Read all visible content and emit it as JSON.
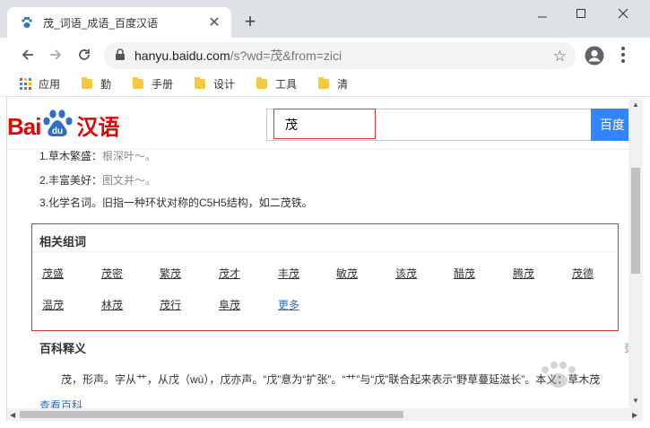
{
  "browser": {
    "tab_title": "茂_词语_成语_百度汉语",
    "url_host": "hanyu.baidu.com",
    "url_path": "/s?wd=茂&from=zici",
    "bookmarks": [
      "应用",
      "勤",
      "手册",
      "设计",
      "工具",
      "清"
    ]
  },
  "site": {
    "logo_bai": "Bai",
    "logo_du": "du",
    "logo_hanyu": "汉语",
    "search_value": "茂",
    "search_button": "百度"
  },
  "definitions": [
    {
      "text": "1.草木繁盛：",
      "example": "根深叶～。"
    },
    {
      "text": "2.丰富美好：",
      "example": "图文并～。"
    },
    {
      "text": "3.化学名词。旧指一种环状对称的C5H5结构，如二茂铁。",
      "example": ""
    }
  ],
  "related": {
    "title": "相关组词",
    "words": [
      "茂盛",
      "茂密",
      "繁茂",
      "茂才",
      "丰茂",
      "敏茂",
      "该茂",
      "醋茂",
      "腾茂",
      "茂德",
      "温茂",
      "林茂",
      "茂行",
      "阜茂"
    ],
    "more": "更多"
  },
  "baike": {
    "title": "百科释义",
    "text": "茂，形声。字从艹，从戊（wù），戊亦声。“戊”意为“扩张”。“艹”与“戊”联合起来表示“野草蔓延滋长”。本义：草木茂",
    "more": "查看百科"
  },
  "colors": {
    "brand_red": "#e10602",
    "brand_blue": "#3385ff",
    "highlight_red": "#cf3636",
    "link_blue": "#2f6fc4"
  }
}
